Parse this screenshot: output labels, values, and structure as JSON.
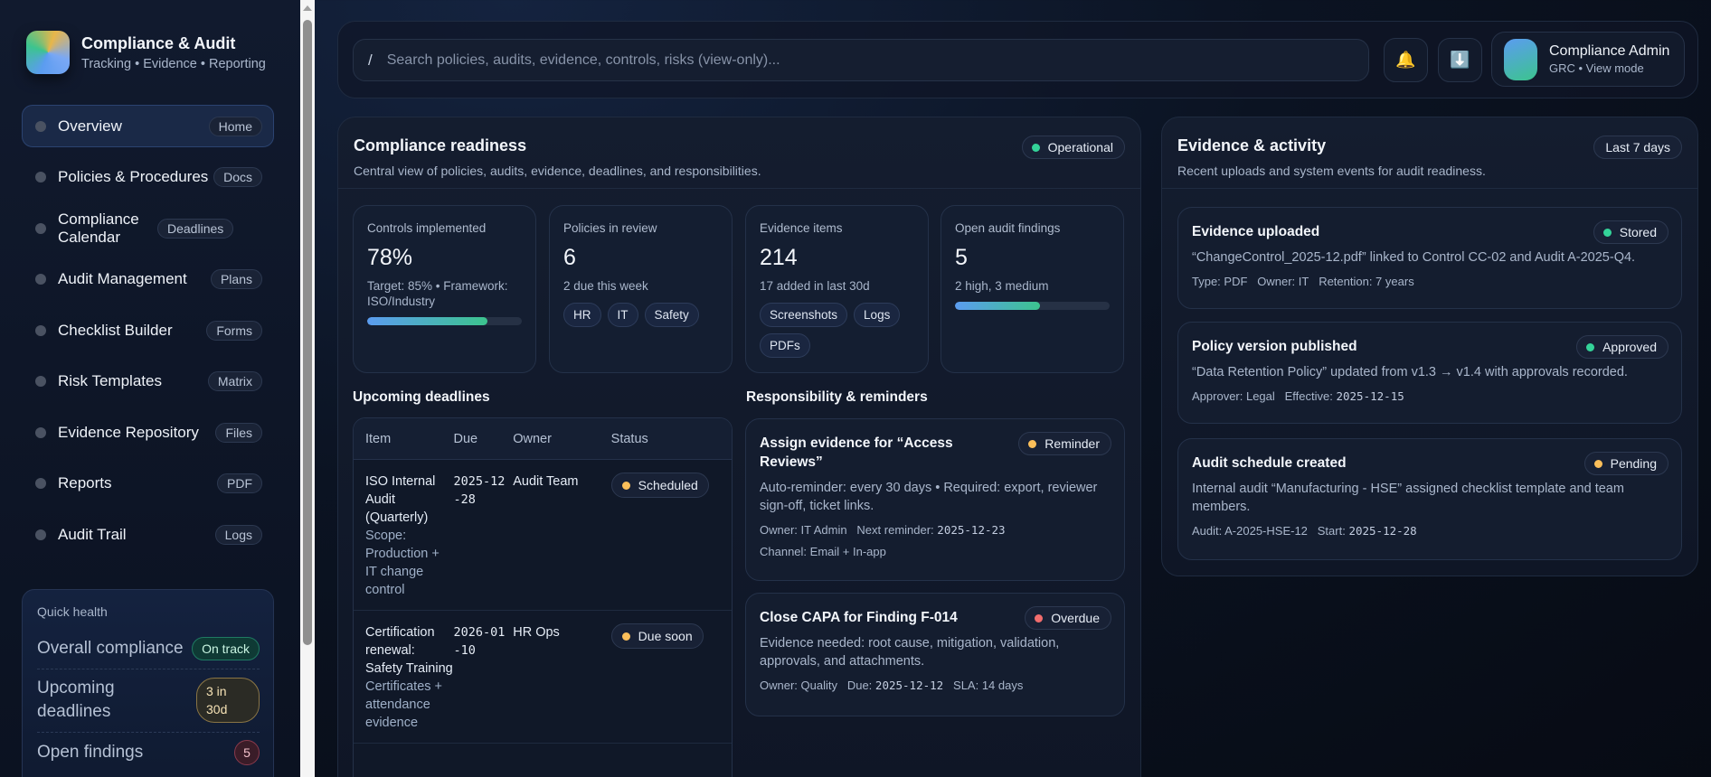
{
  "brand": {
    "title": "Compliance & Audit",
    "subtitle": "Tracking • Evidence • Reporting"
  },
  "nav": [
    {
      "label": "Overview",
      "badge": "Home",
      "active": true
    },
    {
      "label": "Policies & Procedures",
      "badge": "Docs"
    },
    {
      "label": "Compliance Calendar",
      "badge": "Deadlines"
    },
    {
      "label": "Audit Management",
      "badge": "Plans"
    },
    {
      "label": "Checklist Builder",
      "badge": "Forms"
    },
    {
      "label": "Risk Templates",
      "badge": "Matrix"
    },
    {
      "label": "Evidence Repository",
      "badge": "Files"
    },
    {
      "label": "Reports",
      "badge": "PDF"
    },
    {
      "label": "Audit Trail",
      "badge": "Logs"
    }
  ],
  "health": {
    "title": "Quick health",
    "rows": [
      {
        "label": "Overall compliance",
        "value": "On track"
      },
      {
        "label": "Upcoming deadlines",
        "value": "3 in 30d"
      },
      {
        "label": "Open findings",
        "value": "5"
      }
    ]
  },
  "topbar": {
    "search_prefix": "/",
    "search_placeholder": "Search policies, audits, evidence, controls, risks (view-only)...",
    "bell": "🔔",
    "download": "⬇️",
    "user_name": "Compliance Admin",
    "user_sub": "GRC • View mode"
  },
  "readiness": {
    "title": "Compliance readiness",
    "subtitle": "Central view of policies, audits, evidence, deadlines, and responsibilities.",
    "status": "Operational",
    "stats": [
      {
        "label": "Controls implemented",
        "value": "78%",
        "note": "Target: 85% • Framework: ISO/Industry",
        "progress": 78
      },
      {
        "label": "Policies in review",
        "value": "6",
        "note": "2 due this week",
        "chips": [
          "HR",
          "IT",
          "Safety"
        ]
      },
      {
        "label": "Evidence items",
        "value": "214",
        "note": "17 added in last 30d",
        "chips": [
          "Screenshots",
          "Logs",
          "PDFs"
        ]
      },
      {
        "label": "Open audit findings",
        "value": "5",
        "note": "2 high, 3 medium",
        "progress": 55
      }
    ]
  },
  "deadlines": {
    "title": "Upcoming deadlines",
    "columns": [
      "Item",
      "Due",
      "Owner",
      "Status"
    ],
    "rows": [
      {
        "item": "ISO Internal Audit (Quarterly)",
        "detail": "Scope: Production + IT change control",
        "due": "2025-12-28",
        "owner": "Audit Team",
        "status": "Scheduled"
      },
      {
        "item": "Certification renewal: Safety Training",
        "detail": "Certificates + attendance evidence",
        "due": "2026-01-10",
        "owner": "HR Ops",
        "status": "Due soon"
      }
    ]
  },
  "reminders": {
    "title": "Responsibility & reminders",
    "items": [
      {
        "title": "Assign evidence for “Access Reviews”",
        "status": "Reminder",
        "body": "Auto-reminder: every 30 days • Required: export, reviewer sign-off, ticket links.",
        "meta1_a": "Owner: IT Admin",
        "meta1_b": "Next reminder:",
        "meta1_date": "2025-12-23",
        "meta2": "Channel: Email + In-app"
      },
      {
        "title": "Close CAPA for Finding F-014",
        "status": "Overdue",
        "body": "Evidence needed: root cause, mitigation, validation, approvals, and attachments.",
        "meta1_a": "Owner: Quality",
        "meta1_b": "Due:",
        "meta1_date": "2025-12-12",
        "meta1_c": "SLA: 14 days"
      }
    ]
  },
  "activity": {
    "title": "Evidence & activity",
    "subtitle": "Recent uploads and system events for audit readiness.",
    "range": "Last 7 days",
    "items": [
      {
        "title": "Evidence uploaded",
        "status": "Stored",
        "body": "“ChangeControl_2025-12.pdf” linked to Control CC-02 and Audit A-2025-Q4.",
        "meta_a": "Type: PDF",
        "meta_b": "Owner: IT",
        "meta_c": "Retention: 7 years"
      },
      {
        "title": "Policy version published",
        "status": "Approved",
        "body": "“Data Retention Policy” updated from v1.3 → v1.4 with approvals recorded.",
        "meta_a": "Approver: Legal",
        "meta_b": "Effective:",
        "meta_date": "2025-12-15"
      },
      {
        "title": "Audit schedule created",
        "status": "Pending",
        "body": "Internal audit “Manufacturing - HSE” assigned checklist template and team members.",
        "meta_a": "Audit: A-2025-HSE-12",
        "meta_b": "Start:",
        "meta_date": "2025-12-28"
      }
    ]
  },
  "colors": {
    "green": "#34d399",
    "amber": "#fbbf5a",
    "red": "#f26d6d"
  }
}
